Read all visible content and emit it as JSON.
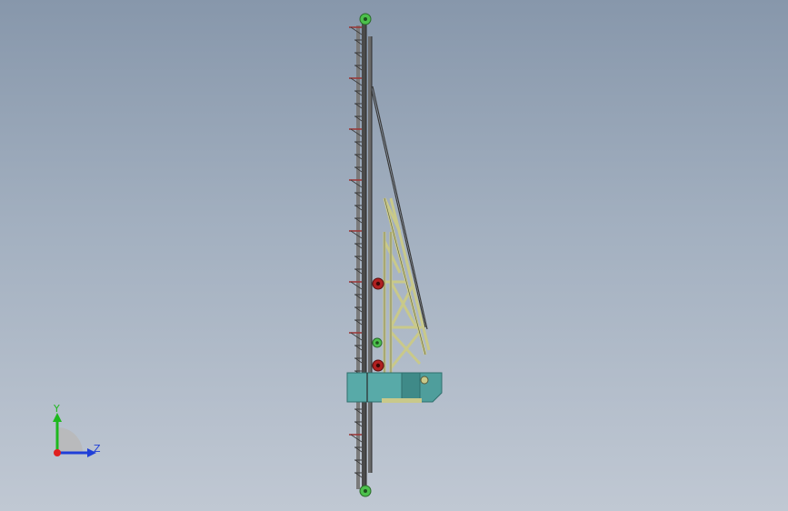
{
  "viewport": {
    "background_top": "#8797ab",
    "background_bottom": "#c0c8d3"
  },
  "model": {
    "colors": {
      "mast_rail": "#5a5a5a",
      "mast_dark": "#2a2a2a",
      "bracket_red": "#9b3a3a",
      "pulley_green": "#4cc04c",
      "pulley_red": "#b02020",
      "boom_yellow": "#c9c98a",
      "cab_teal": "#58aaa8",
      "cab_teal_dark": "#3f8a88",
      "cable": "#3a3a3a"
    },
    "icons": [
      "gear-icon",
      "pulley-icon"
    ]
  },
  "triad": {
    "y_label": "Y",
    "z_label": "Z",
    "colors": {
      "y": "#1eb81e",
      "z": "#1f3fd8",
      "x": "#e02020",
      "arc": "#b8b8b8"
    }
  }
}
